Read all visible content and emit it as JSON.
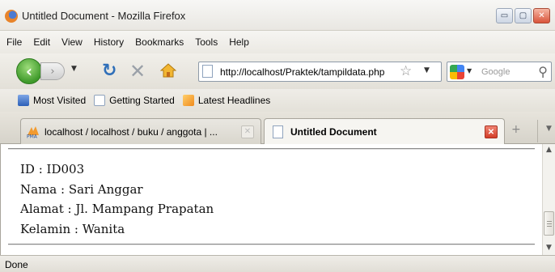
{
  "window": {
    "title": "Untitled Document - Mozilla Firefox",
    "buttons": {
      "minimize": "▭",
      "maximize": "▢",
      "close": "✕"
    }
  },
  "menu": [
    "File",
    "Edit",
    "View",
    "History",
    "Bookmarks",
    "Tools",
    "Help"
  ],
  "nav": {
    "url": "http://localhost/Praktek/tampildata.php",
    "search_placeholder": "Google"
  },
  "bookmarks": [
    "Most Visited",
    "Getting Started",
    "Latest Headlines"
  ],
  "tabs": [
    {
      "label": "localhost / localhost / buku / anggota | ...",
      "active": false
    },
    {
      "label": "Untitled Document",
      "active": true
    }
  ],
  "record": {
    "id_line": "ID : ID003",
    "nama_line": "Nama : Sari Anggar",
    "alamat_line": "Alamat : Jl. Mampang Prapatan",
    "kelamin_line": "Kelamin : Wanita"
  },
  "status": "Done",
  "colors": {
    "back_button": "#3f9a2b",
    "reload": "#2f6fb9",
    "active_tab_close": "#d33d28"
  }
}
